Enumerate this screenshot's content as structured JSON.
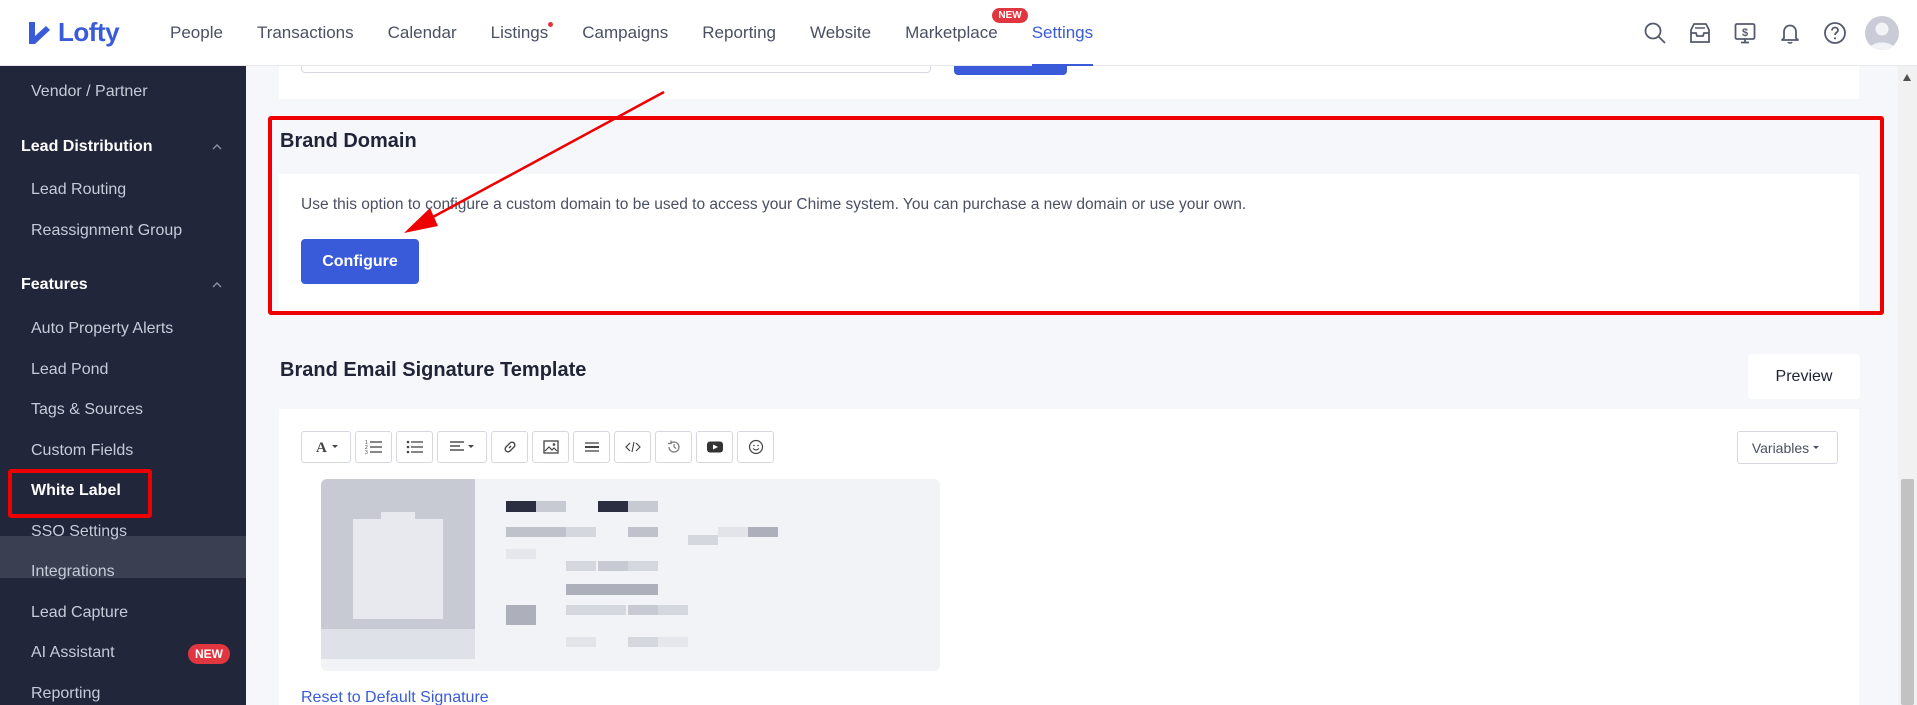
{
  "brand": {
    "name": "Lofty",
    "accent": "#3a5bd9"
  },
  "nav": {
    "items": [
      {
        "label": "People"
      },
      {
        "label": "Transactions"
      },
      {
        "label": "Calendar"
      },
      {
        "label": "Listings"
      },
      {
        "label": "Campaigns"
      },
      {
        "label": "Reporting"
      },
      {
        "label": "Website"
      },
      {
        "label": "Marketplace",
        "badge": "NEW"
      },
      {
        "label": "Settings"
      }
    ],
    "active": "Settings"
  },
  "topIcons": [
    "search-icon",
    "inbox-icon",
    "billing-icon",
    "bell-icon",
    "help-icon",
    "avatar"
  ],
  "sidebar": {
    "items": [
      {
        "label": "Vendor / Partner"
      },
      {
        "label": "Lead Distribution"
      },
      {
        "label": "Lead Routing"
      },
      {
        "label": "Reassignment Group"
      },
      {
        "label": "Features"
      },
      {
        "label": "Auto Property Alerts"
      },
      {
        "label": "Lead Pond"
      },
      {
        "label": "Tags & Sources"
      },
      {
        "label": "Custom Fields"
      },
      {
        "label": "White Label"
      },
      {
        "label": "SSO Settings"
      },
      {
        "label": "Integrations"
      },
      {
        "label": "Lead Capture"
      },
      {
        "label": "AI Assistant",
        "badge": "NEW"
      },
      {
        "label": "Reporting"
      }
    ],
    "active": "White Label"
  },
  "brandDomain": {
    "title": "Brand Domain",
    "description": "Use this option to configure a custom domain to be used to access your Chime system. You can purchase a new domain or use your own.",
    "button": "Configure"
  },
  "signature": {
    "title": "Brand Email Signature Template",
    "preview": "Preview",
    "variables": "Variables",
    "toolbar": [
      "font-icon",
      "ordered-list-icon",
      "bullet-list-icon",
      "align-icon",
      "link-icon",
      "image-icon",
      "divider-icon",
      "code-icon",
      "history-icon",
      "video-icon",
      "emoji-icon"
    ],
    "reset": "Reset to Default Signature"
  },
  "colors": {
    "highlight": "#ee0000",
    "sidebarBg": "#22263a",
    "badge": "#e0363f"
  }
}
